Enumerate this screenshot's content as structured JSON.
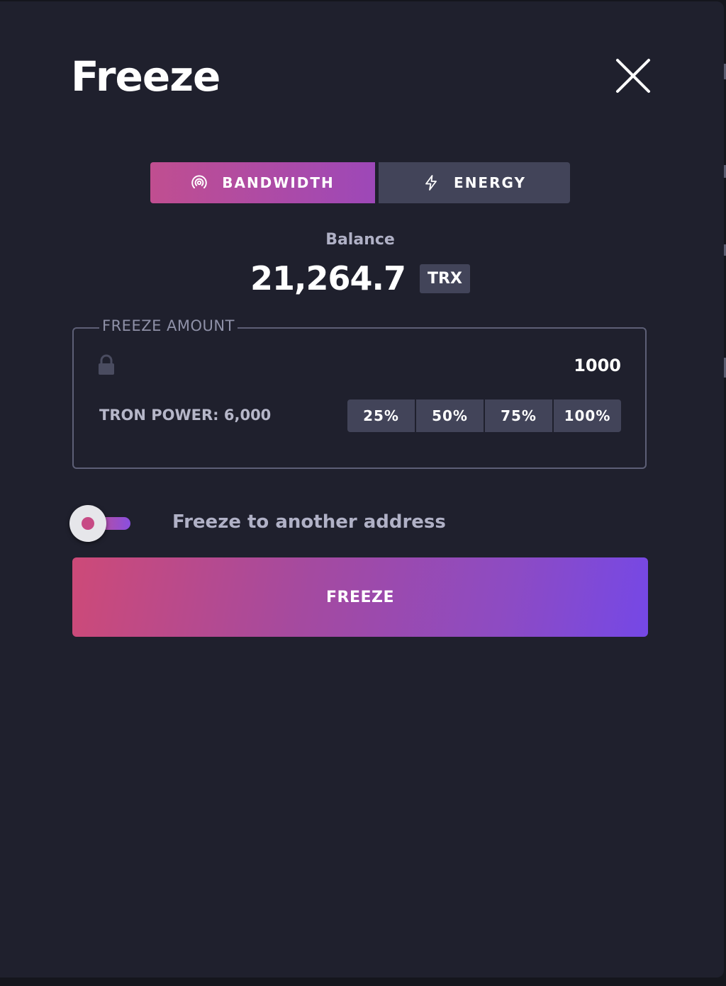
{
  "modal": {
    "title": "Freeze"
  },
  "tabs": [
    {
      "label": "BANDWIDTH",
      "icon": "broadcast-icon",
      "active": true
    },
    {
      "label": "ENERGY",
      "icon": "lightning-icon",
      "active": false
    }
  ],
  "balance": {
    "label": "Balance",
    "value": "21,264.7",
    "currency": "TRX"
  },
  "freeze_amount": {
    "legend": "FREEZE AMOUNT",
    "value": "1000",
    "icon": "lock-icon",
    "tron_power": "TRON POWER: 6,000",
    "percent_buttons": [
      "25%",
      "50%",
      "75%",
      "100%"
    ]
  },
  "another_address": {
    "label": "Freeze to another address",
    "enabled": false
  },
  "submit": {
    "label": "FREEZE"
  },
  "colors": {
    "background": "#1f202d",
    "accent_start": "#cd4a78",
    "accent_end": "#7548e6",
    "panel": "#424459"
  }
}
